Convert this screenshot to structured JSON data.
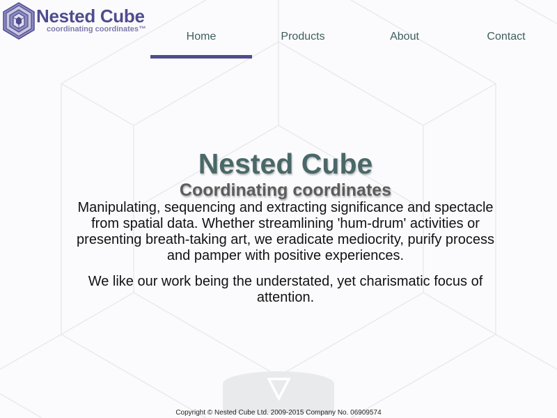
{
  "brand": {
    "name": "Nested Cube",
    "tagline": "coordinating coordinates™"
  },
  "nav": {
    "items": [
      {
        "label": "Home",
        "active": true
      },
      {
        "label": "Products",
        "active": false
      },
      {
        "label": "About",
        "active": false
      },
      {
        "label": "Contact",
        "active": false
      }
    ]
  },
  "hero": {
    "title": "Nested Cube",
    "subtitle": "Coordinating coordinates",
    "paragraphs": [
      "Manipulating, sequencing and extracting significance and spectacle from spatial data. Whether streamlining 'hum-drum' activities or presenting breath-taking art, we eradicate mediocrity, purify process and pamper with positive experiences.",
      "We like our work being the understated, yet charismatic focus of attention."
    ]
  },
  "bottom_tab": {
    "icon": "triangle-down-icon"
  },
  "footer": {
    "copyright": "Copyright © Nested Cube Ltd. 2009-2015 Company No. 06909574"
  },
  "colors": {
    "brand": "#4f4c8e",
    "nav_text": "#3e5d5e",
    "title": "#4a6868",
    "background": "#fbfbfd"
  }
}
